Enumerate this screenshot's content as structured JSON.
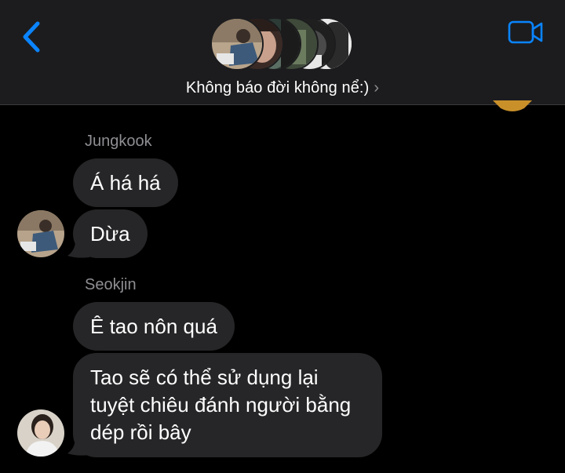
{
  "header": {
    "group_name": "Không báo đời không nể:)",
    "chevron": "›",
    "back_icon": "chevron-left-icon",
    "video_icon": "video-camera-icon",
    "accent_color": "#0a84ff"
  },
  "messages": [
    {
      "sender": "Jungkook",
      "bubbles": [
        "Á há há",
        "Dừa"
      ]
    },
    {
      "sender": "Seokjin",
      "bubbles": [
        "Ê tao nôn quá",
        "Tao sẽ có thể sử dụng lại tuyệt chiêu đánh người bằng dép rồi bây"
      ]
    }
  ]
}
